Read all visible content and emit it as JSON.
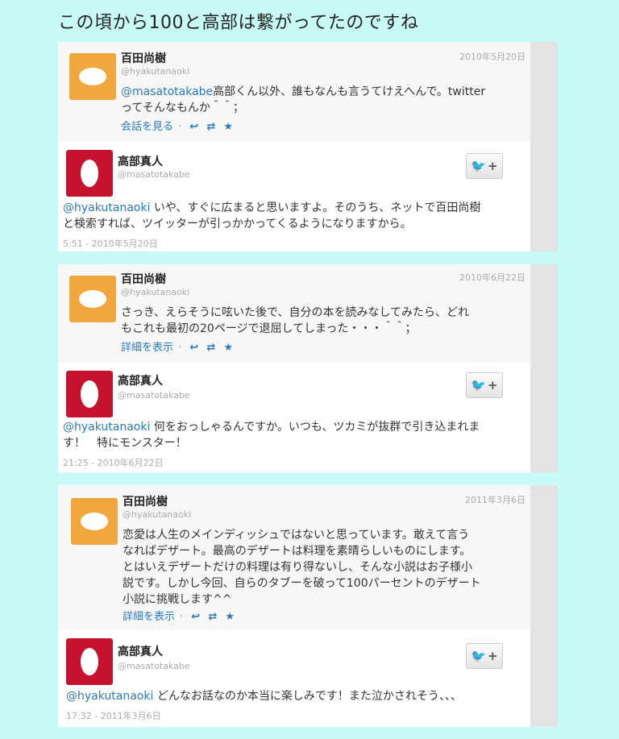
{
  "page_title": "この頃から100と高部は繋がってたのですね",
  "threads": [
    {
      "orig": {
        "name": "百田尚樹",
        "handle": "@hyakutanaoki",
        "date": "2010年5月20日",
        "mention": "@masatotakabe",
        "text_line1": "高部くん以外、誰もなんも言うてけえへんで。twitter",
        "text_line2": "ってそんなもんか＾＾；",
        "action_label": "会話を見る",
        "sep": "·",
        "reply_icon": "↩",
        "retweet_icon": "⇄",
        "fav_icon": "★"
      },
      "reply": {
        "name": "高部真人",
        "handle": "@masatotakabe",
        "mention": "@hyakutanaoki",
        "text_line1": " いや、すぐに広まると思いますよ。そのうち、ネットで百田尚樹",
        "text_line2": "と検索すれば、ツイッターが引っかかってくるようになりますから。",
        "timestamp": "5:51 - 2010年5月20日",
        "follow_bird": "🐦",
        "follow_plus": "+"
      }
    },
    {
      "orig": {
        "name": "百田尚樹",
        "handle": "@hyakutanaoki",
        "date": "2010年6月22日",
        "mention": "",
        "text_line1": "さっき、えらそうに呟いた後で、自分の本を読みなしてみたら、どれ",
        "text_line2": "もこれも最初の20ページで退屈してしまった・・・＾＾；",
        "action_label": "詳細を表示",
        "sep": "·",
        "reply_icon": "↩",
        "retweet_icon": "⇄",
        "fav_icon": "★"
      },
      "reply": {
        "name": "高部真人",
        "handle": "@masatotakabe",
        "mention": "@hyakutanaoki",
        "text_line1": " 何をおっしゃるんですか。いつも、ツカミが抜群で引き込まれま",
        "text_line2": "す！　特にモンスター！",
        "timestamp": "21:25 - 2010年6月22日",
        "follow_bird": "🐦",
        "follow_plus": "+"
      }
    },
    {
      "orig": {
        "name": "百田尚樹",
        "handle": "@hyakutanaoki",
        "date": "2011年3月6日",
        "mention": "",
        "text_line1": "恋愛は人生のメインディッシュではないと思っています。敢えて言う",
        "text_line2": "なればデザート。最高のデザートは料理を素晴らしいものにします。",
        "text_line3": "とはいえデザートだけの料理は有り得ないし、そんな小説はお子様小",
        "text_line4": "説です。しかし今回、自らのタブーを破って100パーセントのデザート",
        "text_line5": "小説に挑戦します^^",
        "action_label": "詳細を表示",
        "sep": "·",
        "reply_icon": "↩",
        "retweet_icon": "⇄",
        "fav_icon": "★"
      },
      "reply": {
        "name": "高部真人",
        "handle": "@masatotakabe",
        "mention": "@hyakutanaoki",
        "text_line1": " どんなお話なのか本当に楽しみです！また泣かされそう、、、",
        "timestamp": "17:32 - 2011年3月6日",
        "follow_bird": "🐦",
        "follow_plus": "+"
      }
    }
  ]
}
